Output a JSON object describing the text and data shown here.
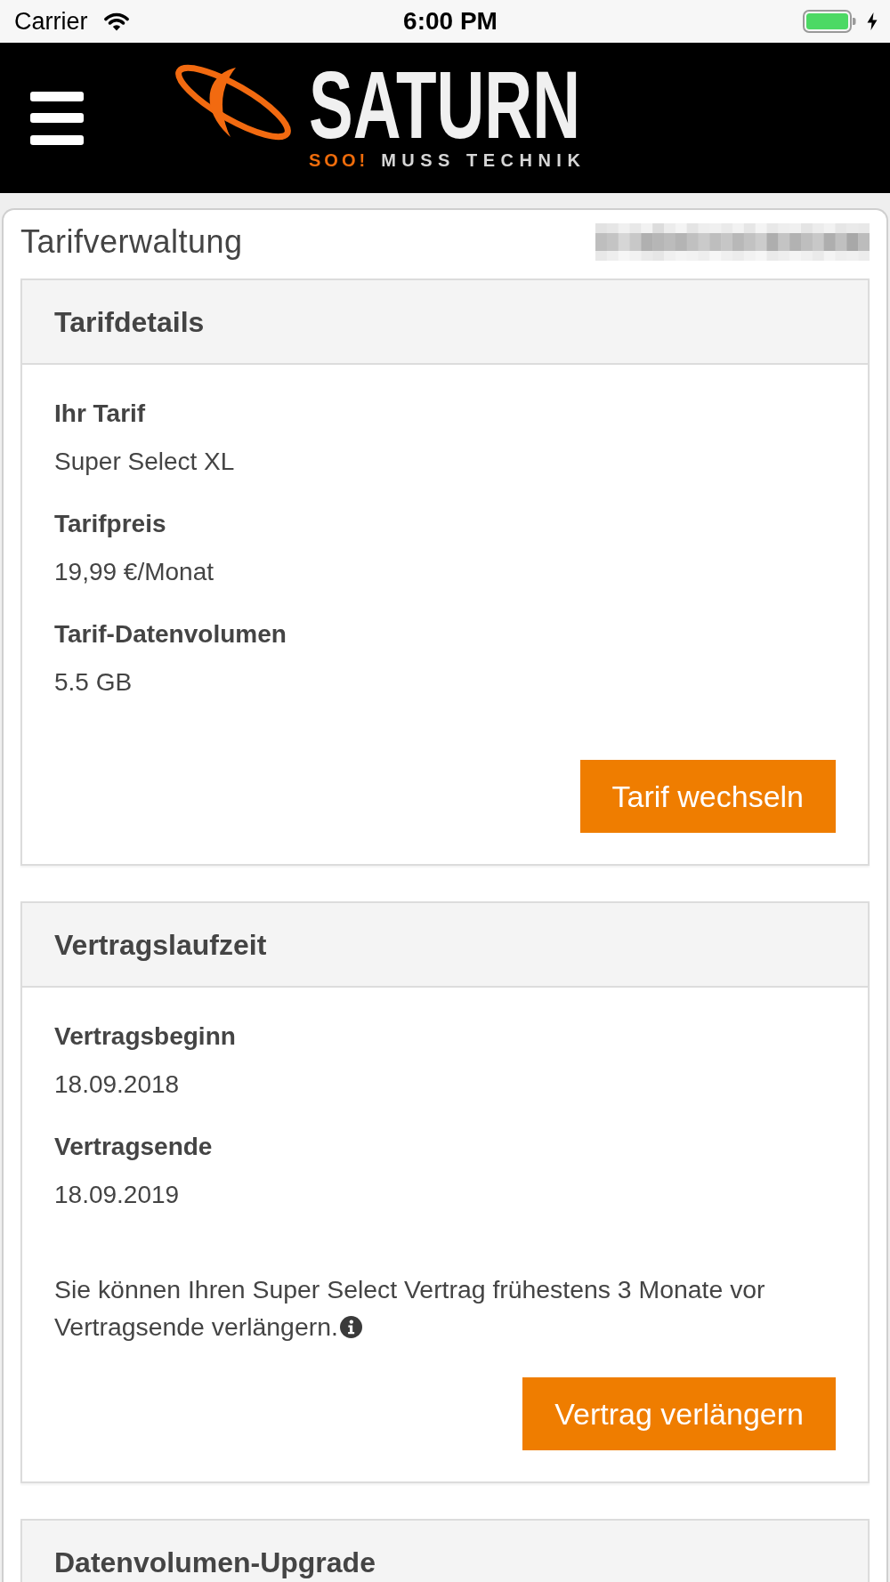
{
  "status_bar": {
    "carrier": "Carrier",
    "time": "6:00 PM"
  },
  "header": {
    "logo": {
      "wordmark": "SATURN",
      "slogan_accent": "SOO!",
      "slogan": "MUSS TECHNIK"
    }
  },
  "page": {
    "title": "Tarifverwaltung"
  },
  "panels": [
    {
      "title": "Tarifdetails",
      "fields": [
        {
          "label": "Ihr Tarif",
          "value": "Super Select XL"
        },
        {
          "label": "Tarifpreis",
          "value": "19,99 €/Monat"
        },
        {
          "label": "Tarif-Datenvolumen",
          "value": "5.5 GB"
        }
      ],
      "button": "Tarif wechseln"
    },
    {
      "title": "Vertragslaufzeit",
      "fields": [
        {
          "label": "Vertragsbeginn",
          "value": "18.09.2018"
        },
        {
          "label": "Vertragsende",
          "value": "18.09.2019"
        }
      ],
      "note": "Sie können Ihren Super Select Vertrag frühestens 3 Monate vor Vertragsende verlängern.",
      "button": "Vertrag verlängern"
    },
    {
      "title": "Datenvolumen-Upgrade"
    }
  ]
}
